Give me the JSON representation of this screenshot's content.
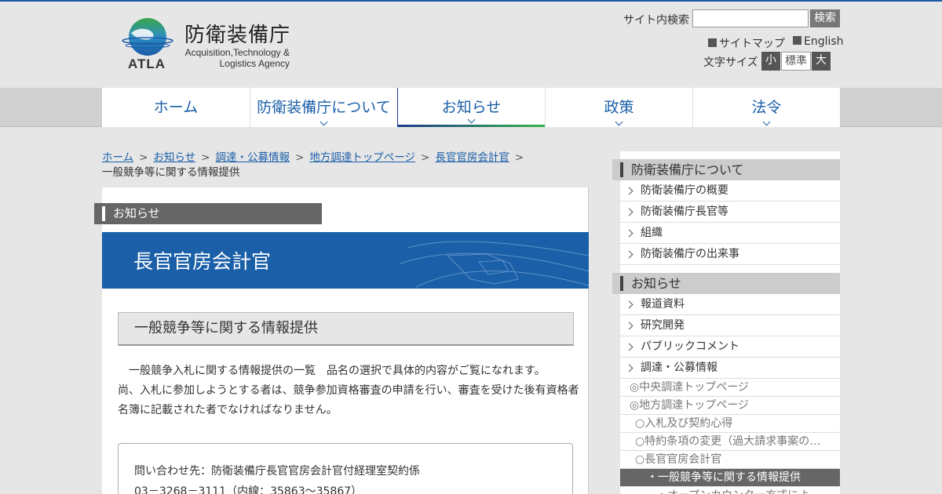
{
  "header": {
    "logo_jp": "防衛装備庁",
    "logo_abbr": "ATLA",
    "logo_en_line1": "Acquisition,Technology &",
    "logo_en_line2": "Logistics Agency",
    "search_label": "サイト内検索",
    "search_value": "",
    "search_button": "検索",
    "links": [
      {
        "label": "サイトマップ"
      },
      {
        "label": "English"
      }
    ],
    "font_size_label": "文字サイズ",
    "font_size_options": [
      "小",
      "標準",
      "大"
    ],
    "font_size_selected": "標準"
  },
  "nav": {
    "items": [
      {
        "label": "ホーム",
        "has_submenu": false
      },
      {
        "label": "防衛装備庁について",
        "has_submenu": true
      },
      {
        "label": "お知らせ",
        "has_submenu": true,
        "active": true
      },
      {
        "label": "政策",
        "has_submenu": true
      },
      {
        "label": "法令",
        "has_submenu": true
      }
    ]
  },
  "breadcrumb": {
    "items": [
      "ホーム",
      "お知らせ",
      "調達・公募情報",
      "地方調達トップページ",
      "長官官房会計官"
    ],
    "separator": ">",
    "current": "一般競争等に関する情報提供"
  },
  "main": {
    "section_tab": "お知らせ",
    "banner_title": "長官官房会計官",
    "page_heading": "一般競争等に関する情報提供",
    "body_line1": "　一般競争入札に関する情報提供の一覧　品名の選択で具体的内容がご覧になれます。",
    "body_line2": "尚、入札に参加しようとする者は、競争参加資格審査の申請を行い、審査を受けた後有資格者名簿に記載された者でなければなりません。",
    "contact_line1": "問い合わせ先：防衛装備庁長官官房会計官付経理室契約係",
    "contact_line2": "03－3268－3111（内線：35863～35867）"
  },
  "sidebar": {
    "group1_title": "防衛装備庁について",
    "group1_items": [
      "防衛装備庁の概要",
      "防衛装備庁長官等",
      "組織",
      "防衛装備庁の出来事"
    ],
    "group2_title": "お知らせ",
    "group2_items": [
      "報道資料",
      "研究開発",
      "パブリックコメント",
      "調達・公募情報"
    ],
    "sub_items": [
      "◎中央調達トップページ",
      "◎地方調達トップページ",
      "○入札及び契約心得",
      "○特約条項の変更（過大請求事案の再発防止等）",
      "○長官官房会計官",
      "・一般競争等に関する情報提供",
      "・オープンカウンター方式による見積"
    ]
  },
  "colors": {
    "brand_blue": "#1a5fa8",
    "header_bg": "#e6e6e6",
    "dark_gray": "#666666"
  }
}
